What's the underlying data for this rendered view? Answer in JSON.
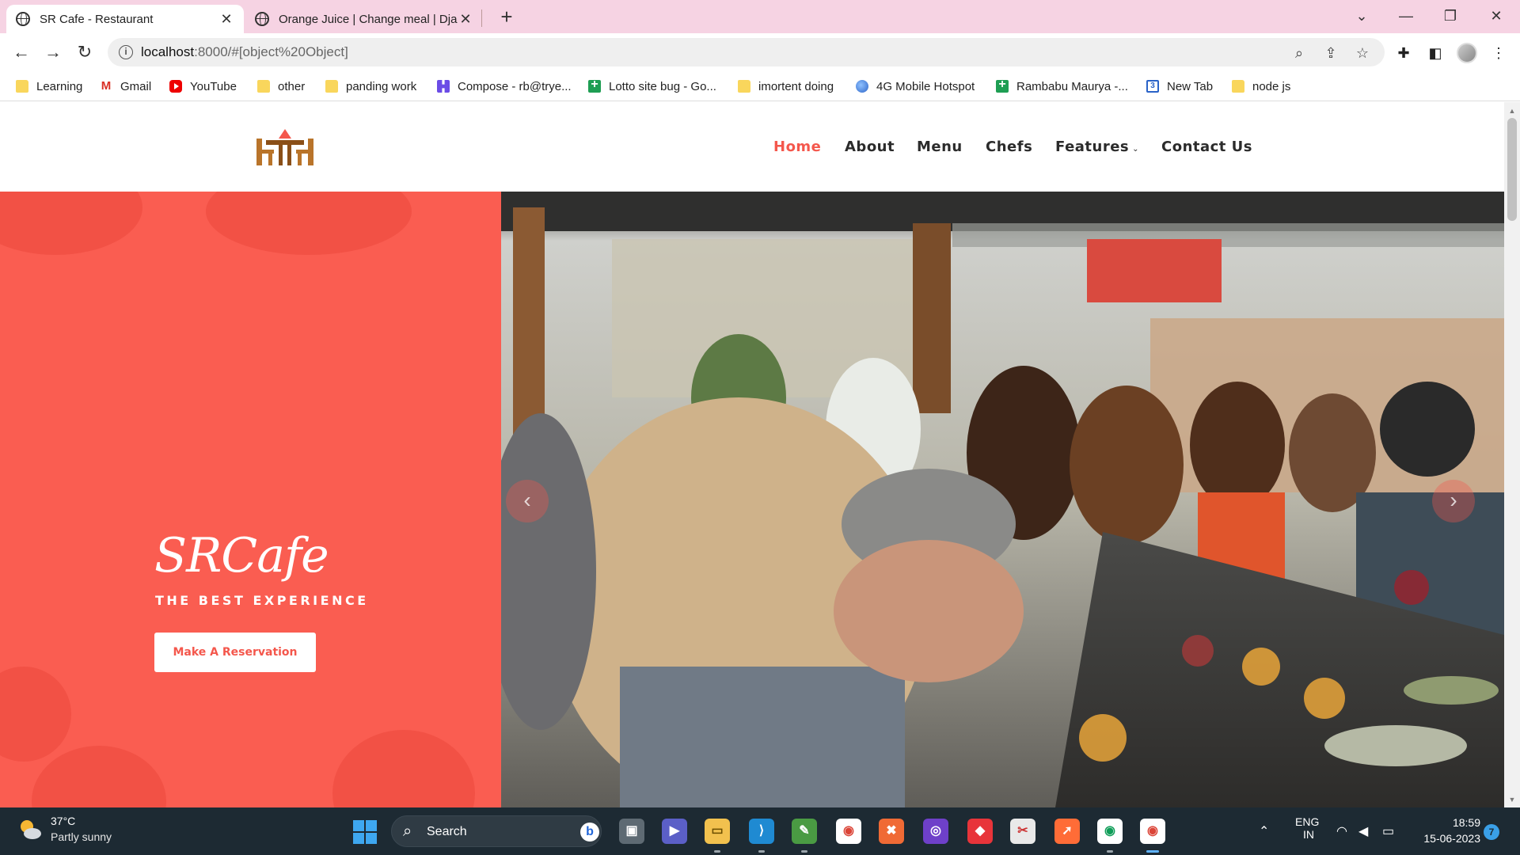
{
  "browser": {
    "tabs": [
      {
        "title": "SR Cafe - Restaurant",
        "active": true
      },
      {
        "title": "Orange Juice | Change meal | Dja",
        "active": false
      }
    ],
    "new_tab_glyph": "+",
    "window_controls": [
      "chevron-down-icon",
      "minimize-icon",
      "restore-icon",
      "close-icon"
    ],
    "address": {
      "host": "localhost",
      "rest": ":8000/#[object%20Object]"
    },
    "bookmarks": [
      {
        "label": "Learning",
        "icon": "folder-icon"
      },
      {
        "label": "Gmail",
        "icon": "gmail-icon"
      },
      {
        "label": "YouTube",
        "icon": "youtube-icon"
      },
      {
        "label": "other",
        "icon": "folder-icon"
      },
      {
        "label": "panding work",
        "icon": "folder-icon"
      },
      {
        "label": "Compose - rb@trye...",
        "icon": "compose-icon"
      },
      {
        "label": "Lotto site bug - Go...",
        "icon": "sheets-icon"
      },
      {
        "label": "imortent doing",
        "icon": "folder-icon"
      },
      {
        "label": "4G Mobile Hotspot",
        "icon": "globe-icon"
      },
      {
        "label": "Rambabu Maurya -...",
        "icon": "sheets-icon"
      },
      {
        "label": "New Tab",
        "icon": "calendar-icon"
      },
      {
        "label": "node js",
        "icon": "folder-icon"
      }
    ]
  },
  "site": {
    "nav": [
      {
        "label": "Home",
        "active": true
      },
      {
        "label": "About",
        "active": false
      },
      {
        "label": "Menu",
        "active": false
      },
      {
        "label": "Chefs",
        "active": false
      },
      {
        "label": "Features",
        "active": false,
        "dropdown": true
      },
      {
        "label": "Contact Us",
        "active": false
      }
    ],
    "hero": {
      "brand": "SRCafe",
      "tagline": "THE BEST EXPERIENCE",
      "cta": "Make A Reservation",
      "prev_glyph": "‹",
      "next_glyph": "›"
    },
    "colors": {
      "accent": "#f4574c",
      "hero_bg": "#fa5d51"
    }
  },
  "taskbar": {
    "weather": {
      "temp": "37°C",
      "desc": "Partly sunny"
    },
    "search_label": "Search",
    "language": [
      "ENG",
      "IN"
    ],
    "time": "18:59",
    "date": "15-06-2023",
    "notifications": "7"
  }
}
